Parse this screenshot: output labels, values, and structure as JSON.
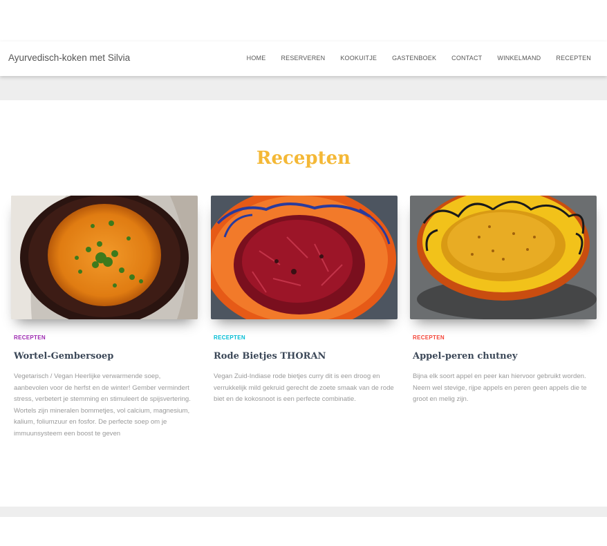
{
  "site": {
    "brand": "Ayurvedisch-koken met Silvia"
  },
  "nav": [
    "HOME",
    "RESERVEREN",
    "KOOKUITJE",
    "GASTENBOEK",
    "CONTACT",
    "WINKELMAND",
    "RECEPTEN"
  ],
  "section": {
    "title": "Recepten"
  },
  "cards": [
    {
      "category": "RECEPTEN",
      "category_color": "#9c27b0",
      "title": "Wortel-Gembersoep",
      "description": "Vegetarisch / Vegan Heerlijke verwarmende soep, aanbevolen voor de herfst en de winter! Gember vermindert stress, verbetert je stemming en stimuleert de spijsvertering. Wortels zijn mineralen bommetjes, vol calcium, magnesium, kalium, foliumzuur en fosfor. De perfecte soep om je immuunsysteem een boost te geven",
      "image_icon": "carrot-soup-photo"
    },
    {
      "category": "RECEPTEN",
      "category_color": "#00bcd4",
      "title": "Rode Bietjes THORAN",
      "description": "Vegan Zuid-Indiase rode bietjes curry dit is een droog en verrukkelijk mild gekruid gerecht de zoete smaak van de rode biet en de kokosnoot is een perfecte combinatie.",
      "image_icon": "beetroot-thoran-photo"
    },
    {
      "category": "RECEPTEN",
      "category_color": "#f44336",
      "title": "Appel-peren chutney",
      "description": "Bijna elk soort appel en peer kan hiervoor gebruikt worden. Neem wel stevige, rijpe appels en peren geen appels die te groot en melig zijn.",
      "image_icon": "apple-pear-chutney-photo"
    }
  ]
}
